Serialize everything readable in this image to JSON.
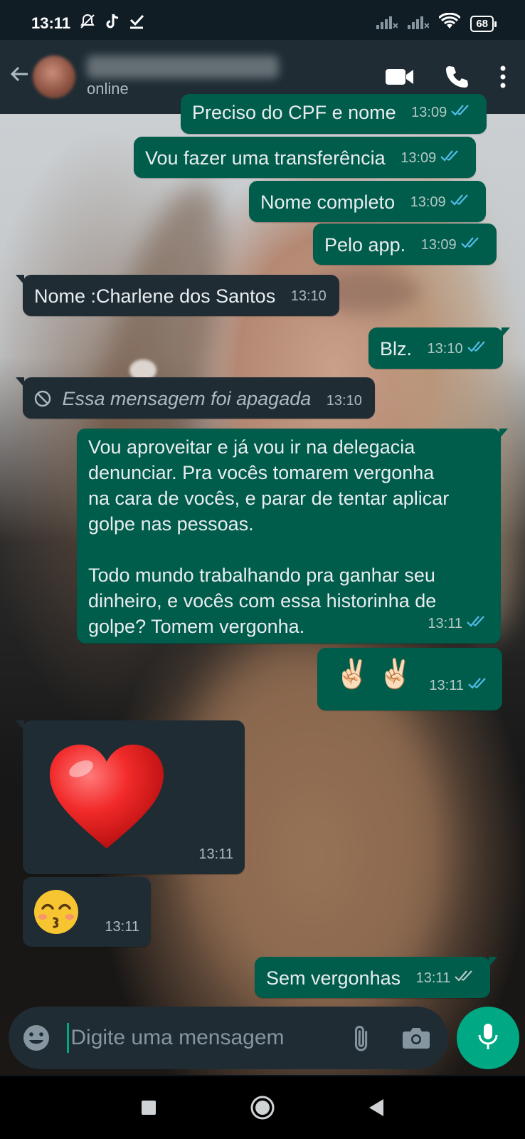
{
  "status_bar": {
    "time": "13:11",
    "battery": "68"
  },
  "header": {
    "contact_status": "online"
  },
  "messages": [
    {
      "dir": "out",
      "text": "Preciso do CPF e nome",
      "time": "13:09",
      "status": "read"
    },
    {
      "dir": "out",
      "text": "Vou fazer uma transferência",
      "time": "13:09",
      "status": "read"
    },
    {
      "dir": "out",
      "text": "Nome completo",
      "time": "13:09",
      "status": "read"
    },
    {
      "dir": "out",
      "text": "Pelo app.",
      "time": "13:09",
      "status": "read"
    },
    {
      "dir": "in",
      "text": "Nome :Charlene dos Santos",
      "time": "13:10"
    },
    {
      "dir": "out",
      "text": "Blz.",
      "time": "13:10",
      "status": "read"
    },
    {
      "dir": "in",
      "text": "Essa mensagem foi apagada",
      "time": "13:10",
      "deleted": true
    },
    {
      "dir": "out",
      "text": "Vou aproveitar e já vou ir na delegacia\ndenunciar. Pra vocês tomarem vergonha\nna cara de vocês, e parar de tentar aplicar\ngolpe nas pessoas.\n\nTodo mundo trabalhando pra ganhar seu\ndinheiro, e vocês com essa historinha de\ngolpe? Tomem vergonha.",
      "time": "13:11",
      "status": "read"
    },
    {
      "dir": "out",
      "text": "✌🏻 ✌🏻",
      "time": "13:11",
      "status": "read"
    },
    {
      "dir": "in",
      "text": "❤️",
      "time": "13:11"
    },
    {
      "dir": "in",
      "text": "😙",
      "time": "13:11"
    },
    {
      "dir": "out",
      "text": "Sem vergonhas",
      "time": "13:11",
      "status": "delivered"
    }
  ],
  "input": {
    "placeholder": "Digite uma mensagem"
  },
  "colors": {
    "outgoing_bubble": "#005c4b",
    "incoming_bubble": "#1f2c34",
    "header": "#1f2c34",
    "accent": "#00a884",
    "read_tick": "#53bdeb",
    "delivered_tick": "#b4c9c4"
  },
  "icons": {
    "header": [
      "back-arrow-icon",
      "video-call-icon",
      "phone-icon",
      "more-vert-icon"
    ],
    "input": [
      "emoji-icon",
      "attach-icon",
      "camera-icon",
      "mic-icon"
    ],
    "nav": [
      "recents-icon",
      "home-icon",
      "back-icon"
    ]
  }
}
